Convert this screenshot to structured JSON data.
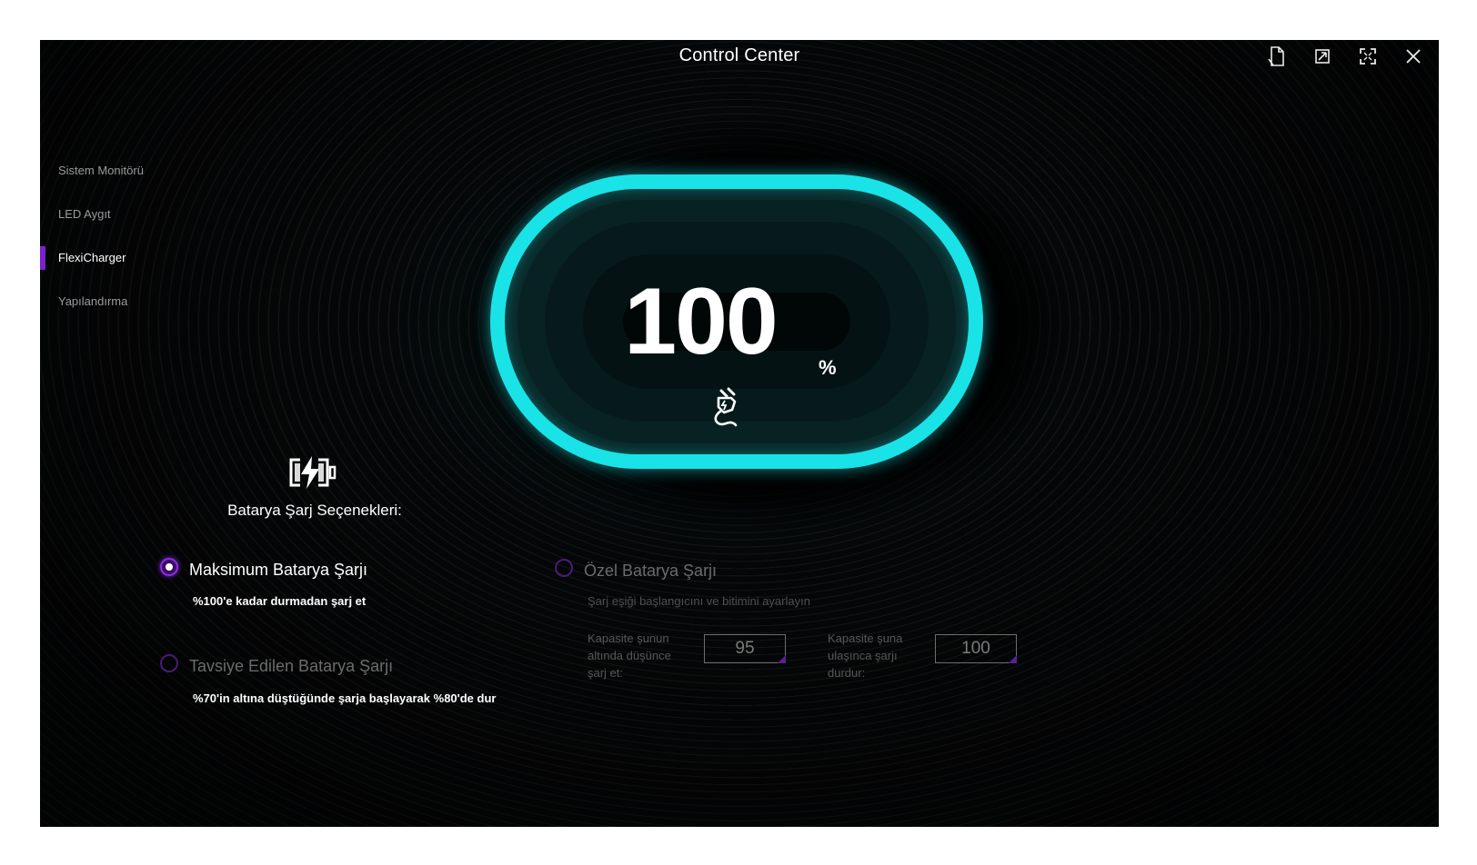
{
  "window": {
    "title": "Control Center",
    "controls": [
      "help-doc-icon",
      "restore-icon",
      "fullscreen-icon",
      "close-icon"
    ]
  },
  "sidebar": {
    "items": [
      {
        "label": "Sistem Monitörü",
        "active": false
      },
      {
        "label": "LED Aygıt",
        "active": false
      },
      {
        "label": "FlexiCharger",
        "active": true
      },
      {
        "label": "Yapılandırma",
        "active": false
      }
    ]
  },
  "battery": {
    "percent": "100",
    "unit": "%",
    "status_icon": "plug-icon",
    "ring_color": "#19e3e6"
  },
  "options": {
    "title": "Batarya Şarj Seçenekleri:",
    "icon": "battery-charge-icon",
    "max": {
      "label": "Maksimum Batarya Şarjı",
      "desc": "%100'e kadar durmadan şarj et",
      "selected": true
    },
    "recommended": {
      "label": "Tavsiye Edilen Batarya Şarjı",
      "desc": "%70'in altına düştüğünde şarja başlayarak %80'de dur",
      "selected": false
    },
    "custom": {
      "label": "Özel Batarya Şarjı",
      "desc": "Şarj eşiği başlangıcını ve bitimini ayarlayın",
      "selected": false,
      "start_label": "Kapasite şunun altında düşünce şarj et:",
      "start_value": "95",
      "stop_label": "Kapasite şuna ulaşınca şarjı durdur:",
      "stop_value": "100"
    }
  },
  "colors": {
    "accent": "#8a2be2",
    "sidebar_active": "#7b1fd1",
    "background": "#050607"
  }
}
